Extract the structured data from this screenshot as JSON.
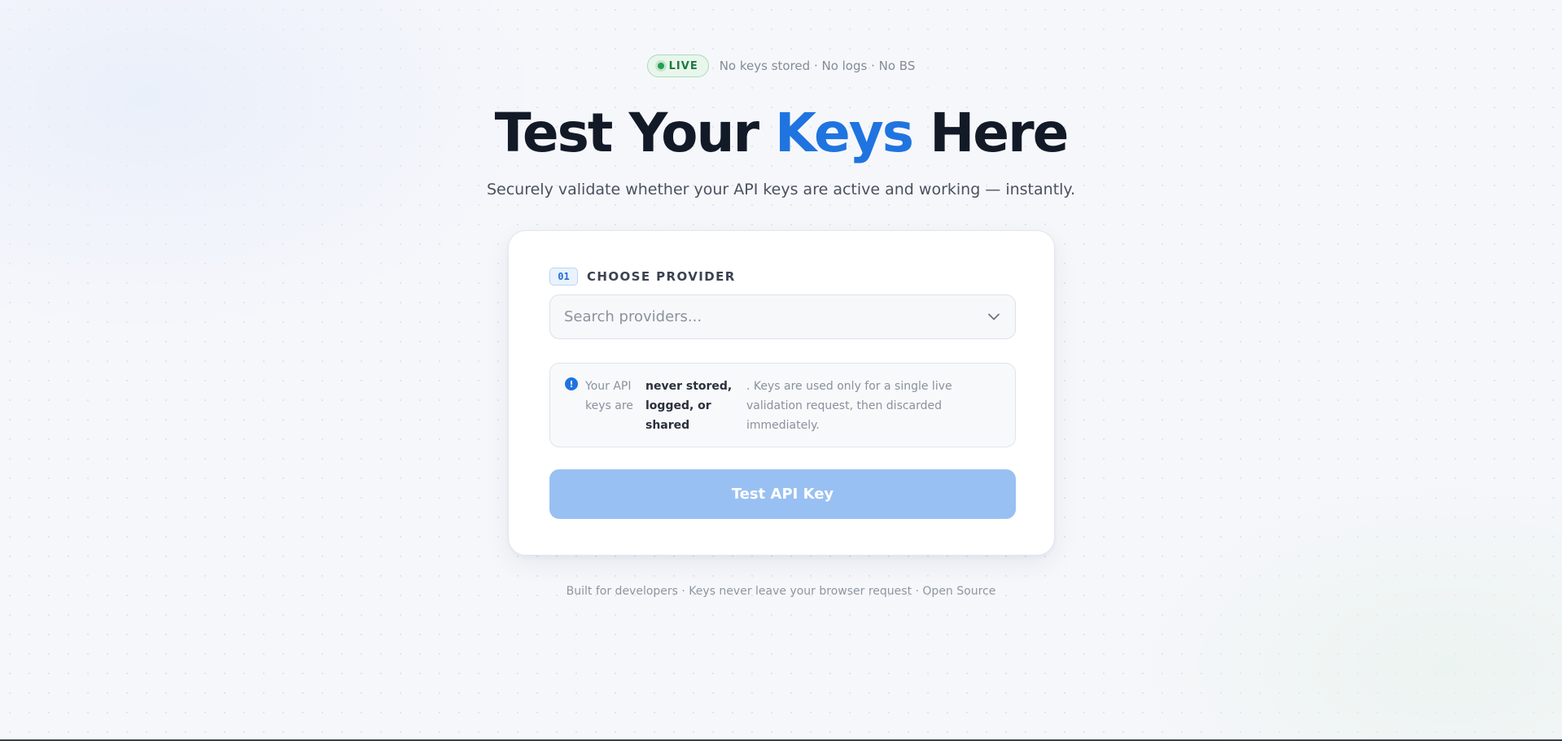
{
  "badge": {
    "status_label": "LIVE",
    "tagline": "No keys stored · No logs · No BS"
  },
  "hero": {
    "title_before": "Test Your ",
    "title_accent": "Keys",
    "title_after": " Here",
    "subtitle": "Securely validate whether your API keys are active and working — instantly."
  },
  "step": {
    "number": "01",
    "label": "CHOOSE PROVIDER"
  },
  "provider_select": {
    "placeholder": "Search providers...",
    "value": "",
    "icon": "chevron-down-icon"
  },
  "notice": {
    "icon": "info-icon",
    "part1": "Your API keys are",
    "part2": "never stored, logged, or shared",
    "part3": ". Keys are used only for a single live validation request, then discarded immediately."
  },
  "action": {
    "test_label": "Test API Key"
  },
  "footer": {
    "text": "Built for developers · Keys never leave your browser request · Open Source"
  },
  "colors": {
    "accent": "#1f74e0",
    "live_green": "#22a04f",
    "button_disabled": "#99c0f2"
  }
}
